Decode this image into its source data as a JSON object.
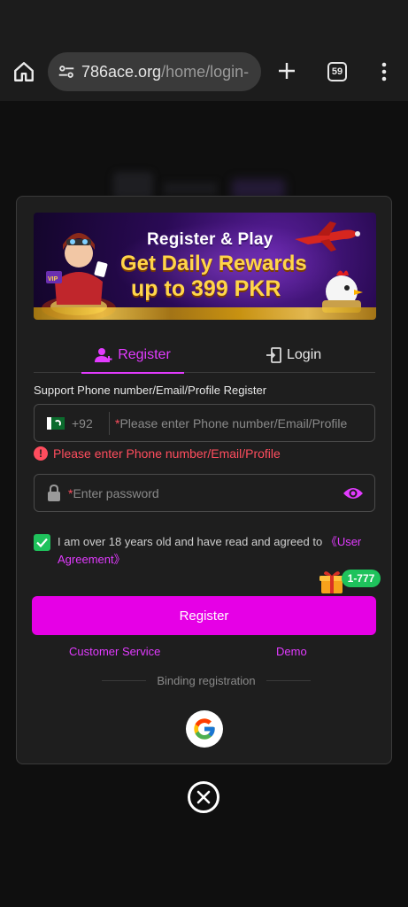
{
  "browser": {
    "url_host": "786ace.org",
    "url_path": "/home/login-",
    "tab_count": "59",
    "icons": [
      "home-icon",
      "site-settings-icon",
      "new-tab-icon",
      "tab-switcher-icon",
      "menu-icon"
    ]
  },
  "banner": {
    "line1": "Register & Play",
    "line2": "Get Daily Rewards",
    "line3": "up to 399 PKR"
  },
  "tabs": {
    "register": "Register",
    "login": "Login"
  },
  "form": {
    "support_label": "Support Phone number/Email/Profile Register",
    "country_code": "+92",
    "required_mark": "*",
    "phone_placeholder": "Please enter Phone number/Email/Profile",
    "phone_error": "Please enter Phone number/Email/Profile",
    "password_placeholder": "Enter password",
    "agree_text": "I am over 18 years old and have read and agreed to ",
    "agree_link": "《User Agreement》",
    "agree_checked": true,
    "gift_badge": "1-777",
    "register_button": "Register",
    "customer_service": "Customer Service",
    "demo": "Demo",
    "binding": "Binding registration"
  },
  "colors": {
    "accent": "#e600e6",
    "link": "#e23bff",
    "error": "#ff4d5e",
    "success": "#1fc25c"
  }
}
